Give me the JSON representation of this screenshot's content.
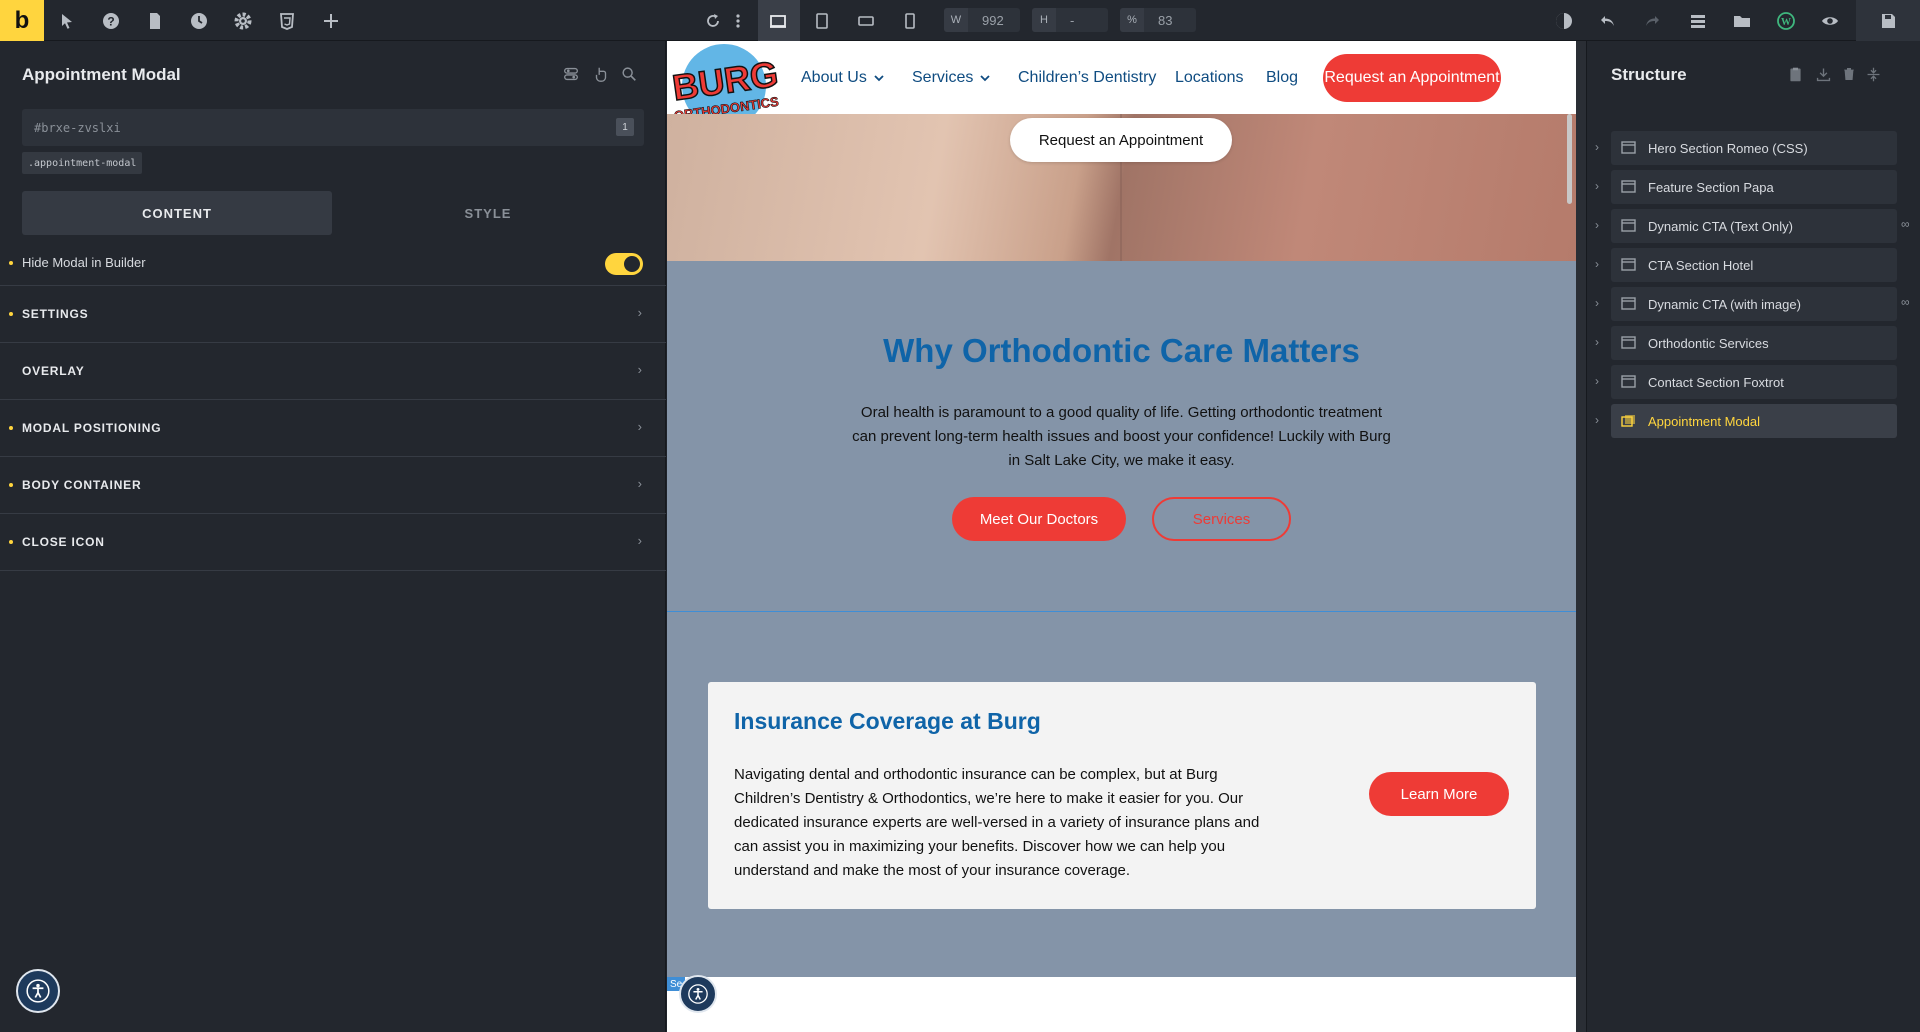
{
  "brand": {
    "letter": "b"
  },
  "toolbar": {
    "width_label": "W",
    "width_value": "992",
    "height_label": "H",
    "height_value": "-",
    "zoom_label": "%",
    "zoom_value": "83"
  },
  "left_panel": {
    "title": "Appointment Modal",
    "element_id": "#brxe-zvslxi",
    "id_badge": "1",
    "class_name": ".appointment-modal",
    "tabs": {
      "content": "CONTENT",
      "style": "STYLE"
    },
    "hide_modal_label": "Hide Modal in Builder",
    "sections": [
      {
        "label": "SETTINGS",
        "dot": true
      },
      {
        "label": "OVERLAY",
        "dot": false
      },
      {
        "label": "MODAL POSITIONING",
        "dot": true
      },
      {
        "label": "BODY CONTAINER",
        "dot": true
      },
      {
        "label": "CLOSE ICON",
        "dot": true
      }
    ]
  },
  "site": {
    "logo_text_top": "BURG",
    "logo_text_bottom": "ORTHODONTICS",
    "nav": [
      {
        "label": "About Us",
        "dropdown": true
      },
      {
        "label": "Services",
        "dropdown": true
      },
      {
        "label": "Children’s Dentistry",
        "dropdown": false
      },
      {
        "label": "Locations",
        "dropdown": false
      },
      {
        "label": "Blog",
        "dropdown": false
      }
    ],
    "nav_cta": "Request an Appointment",
    "hero_cta": "Request an Appointment",
    "why": {
      "title": "Why Orthodontic Care Matters",
      "text": "Oral health is paramount to a good quality of life. Getting orthodontic treatment can prevent long-term health issues and boost your confidence! Luckily with Burg in Salt Lake City, we make it easy.",
      "primary_button": "Meet Our Doctors",
      "secondary_button": "Services"
    },
    "insurance": {
      "title": "Insurance Coverage at Burg",
      "text": "Navigating dental and orthodontic insurance can be complex, but at Burg Children’s Dentistry & Orthodontics, we’re here to make it easier for you. Our dedicated insurance experts are well-versed in a variety of insurance plans and can assist you in maximizing your benefits. Discover how we can help you understand and make the most of your insurance coverage.",
      "button": "Learn More"
    },
    "section_tag": "Se"
  },
  "right_panel": {
    "title": "Structure",
    "items": [
      {
        "label": "Hero Section Romeo (CSS)",
        "linked": false,
        "active": false
      },
      {
        "label": "Feature Section Papa",
        "linked": false,
        "active": false
      },
      {
        "label": "Dynamic CTA (Text Only)",
        "linked": true,
        "active": false
      },
      {
        "label": "CTA Section Hotel",
        "linked": false,
        "active": false
      },
      {
        "label": "Dynamic CTA (with image)",
        "linked": true,
        "active": false
      },
      {
        "label": "Orthodontic Services",
        "linked": false,
        "active": false
      },
      {
        "label": "Contact Section Foxtrot",
        "linked": false,
        "active": false
      },
      {
        "label": "Appointment Modal",
        "linked": false,
        "active": true
      }
    ]
  },
  "colors": {
    "accent": "#ffd53e",
    "brand_red": "#ee3b36",
    "brand_blue": "#0f64a8",
    "panel_bg": "#23272e"
  }
}
